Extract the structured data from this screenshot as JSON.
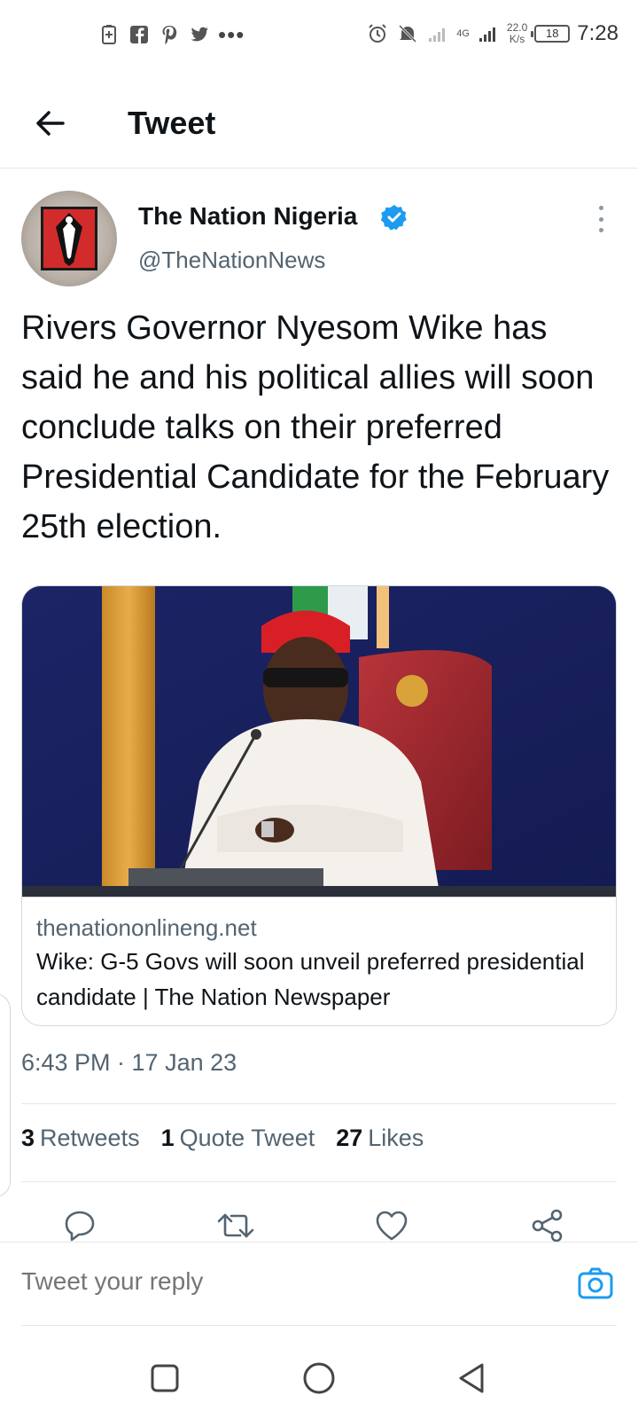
{
  "status_bar": {
    "time": "7:28",
    "network_speed": "22.0",
    "network_speed_unit": "K/s",
    "network_type": "4G",
    "battery": "18"
  },
  "header": {
    "title": "Tweet"
  },
  "author": {
    "name": "The Nation Nigeria",
    "handle": "@TheNationNews",
    "verified": true
  },
  "tweet": {
    "text": "Rivers Governor Nyesom Wike has said he and his political allies will soon conclude talks on their preferred Presidential Candidate for the February 25th election.",
    "timestamp": "6:43 PM · 17 Jan 23"
  },
  "card": {
    "domain": "thenationonlineng.net",
    "title": "Wike: G-5 Govs will soon unveil preferred presidential candidate | The Nation Newspaper"
  },
  "stats": [
    {
      "count": "3",
      "label": "Retweets"
    },
    {
      "count": "1",
      "label": "Quote Tweet"
    },
    {
      "count": "27",
      "label": "Likes"
    }
  ],
  "reply": {
    "placeholder": "Tweet your reply"
  },
  "colors": {
    "accent": "#1d9bf0",
    "secondary_text": "#536471",
    "primary_text": "#0f1419"
  }
}
